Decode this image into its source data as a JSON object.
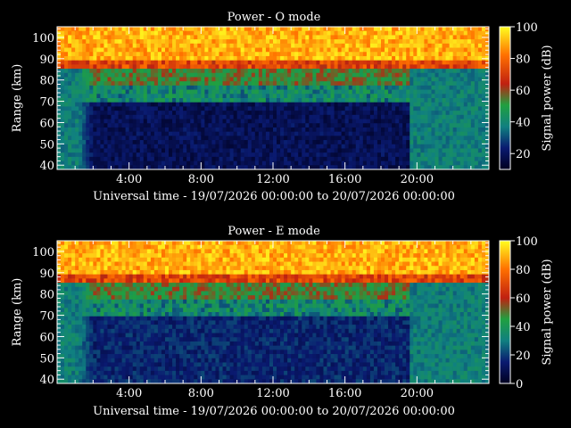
{
  "chart_data": [
    {
      "type": "heatmap",
      "title": "Power - O mode",
      "xlabel": "Universal time - 19/07/2026 00:00:00 to 20/07/2026 00:00:00",
      "ylabel": "Range (km)",
      "x_ticks": [
        "4:00",
        "8:00",
        "12:00",
        "16:00",
        "20:00"
      ],
      "x_tick_hours": [
        4,
        8,
        12,
        16,
        20
      ],
      "xlim": [
        0,
        24
      ],
      "y_ticks": [
        40,
        50,
        60,
        70,
        80,
        90,
        100
      ],
      "ylim": [
        38,
        105
      ],
      "colorbar": {
        "label": "Signal power (dB)",
        "ticks": [
          20,
          40,
          60,
          80,
          100
        ],
        "range": [
          10,
          100
        ]
      }
    },
    {
      "type": "heatmap",
      "title": "Power - E mode",
      "xlabel": "Universal time - 19/07/2026 00:00:00 to 20/07/2026 00:00:00",
      "ylabel": "Range (km)",
      "x_ticks": [
        "4:00",
        "8:00",
        "12:00",
        "16:00",
        "20:00"
      ],
      "x_tick_hours": [
        4,
        8,
        12,
        16,
        20
      ],
      "xlim": [
        0,
        24
      ],
      "y_ticks": [
        40,
        50,
        60,
        70,
        80,
        90,
        100
      ],
      "ylim": [
        38,
        105
      ],
      "colorbar": {
        "label": "Signal power (dB)",
        "ticks": [
          0,
          20,
          40,
          60,
          80,
          100
        ],
        "range": [
          0,
          100
        ]
      }
    }
  ]
}
